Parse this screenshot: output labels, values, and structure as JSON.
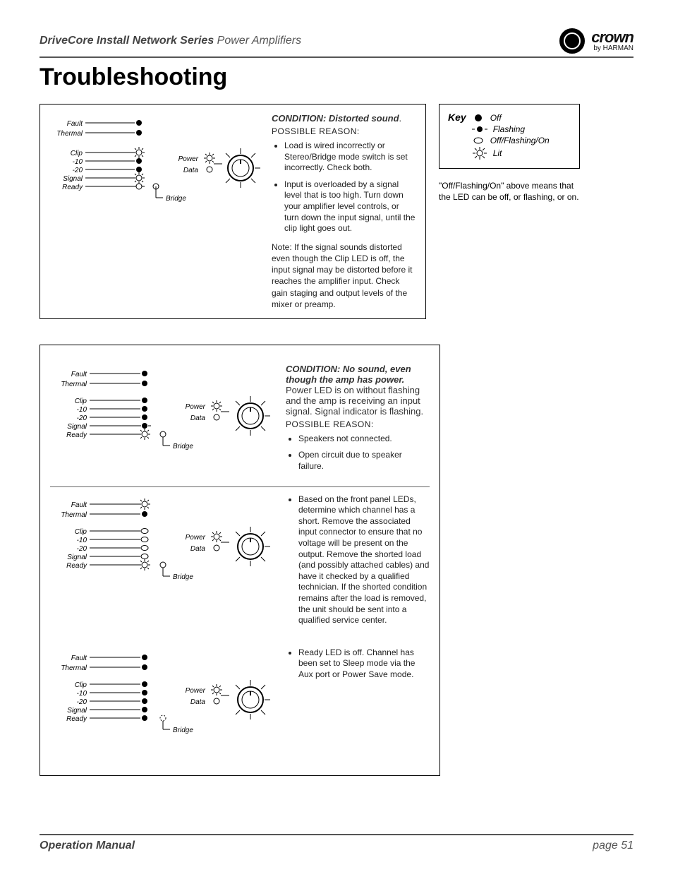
{
  "header": {
    "series_bold": "DriveCore Install Network Series",
    "series_light": " Power Amplifiers",
    "brand": "crown",
    "by": "by HARMAN"
  },
  "title": "Troubleshooting",
  "led_labels": {
    "fault": "Fault",
    "thermal": "Thermal",
    "clip": "Clip",
    "m10": "-10",
    "m20": "-20",
    "signal": "Signal",
    "ready": "Ready",
    "bridge": "Bridge",
    "power": "Power",
    "data": "Data"
  },
  "key": {
    "heading": "Key",
    "off": "Off",
    "flashing": "Flashing",
    "any": "Off/Flashing/On",
    "lit": "Lit",
    "note": "\"Off/Flashing/On\" above means that the LED can be off, or flashing, or on."
  },
  "block1": {
    "condition": "CONDITION: Distorted sound",
    "condition_suffix": ".",
    "possible": "POSSIBLE REASON:",
    "bullets": [
      "Load is wired incorrectly or Stereo/Bridge mode switch is set incorrectly. Check both.",
      "Input is overloaded by a signal level that is too high. Turn down your amplifier level controls, or turn down the input signal, until the clip light goes out."
    ],
    "note": "Note: If the signal sounds distorted even though the Clip LED is off, the input signal may be distorted before it reaches the amplifier input. Check gain staging and output levels of the mixer or preamp."
  },
  "block2a": {
    "condition_bold": "CONDITION: No sound, even though the amp has power.",
    "condition_rest": " Power LED is on without flashing and the amp is receiving an input signal. Signal indicator is flashing.",
    "possible": "POSSIBLE REASON:",
    "bullets": [
      "Speakers not connected.",
      "Open circuit due to speaker failure."
    ]
  },
  "block2b": {
    "bullets": [
      "Based on the front panel LEDs, determine which channel has a short. Remove the associated input connector to ensure that no voltage will be present on the output. Remove the shorted load (and possibly attached cables) and have it checked by a qualified technician. If the shorted condition remains after the load is removed, the unit should be sent into a qualified service center."
    ]
  },
  "block2c": {
    "bullets": [
      "Ready LED is off. Channel has been set to Sleep mode via the Aux port or Power Save mode."
    ]
  },
  "footer": {
    "left": "Operation Manual",
    "right_prefix": "page ",
    "right_num": "51"
  }
}
